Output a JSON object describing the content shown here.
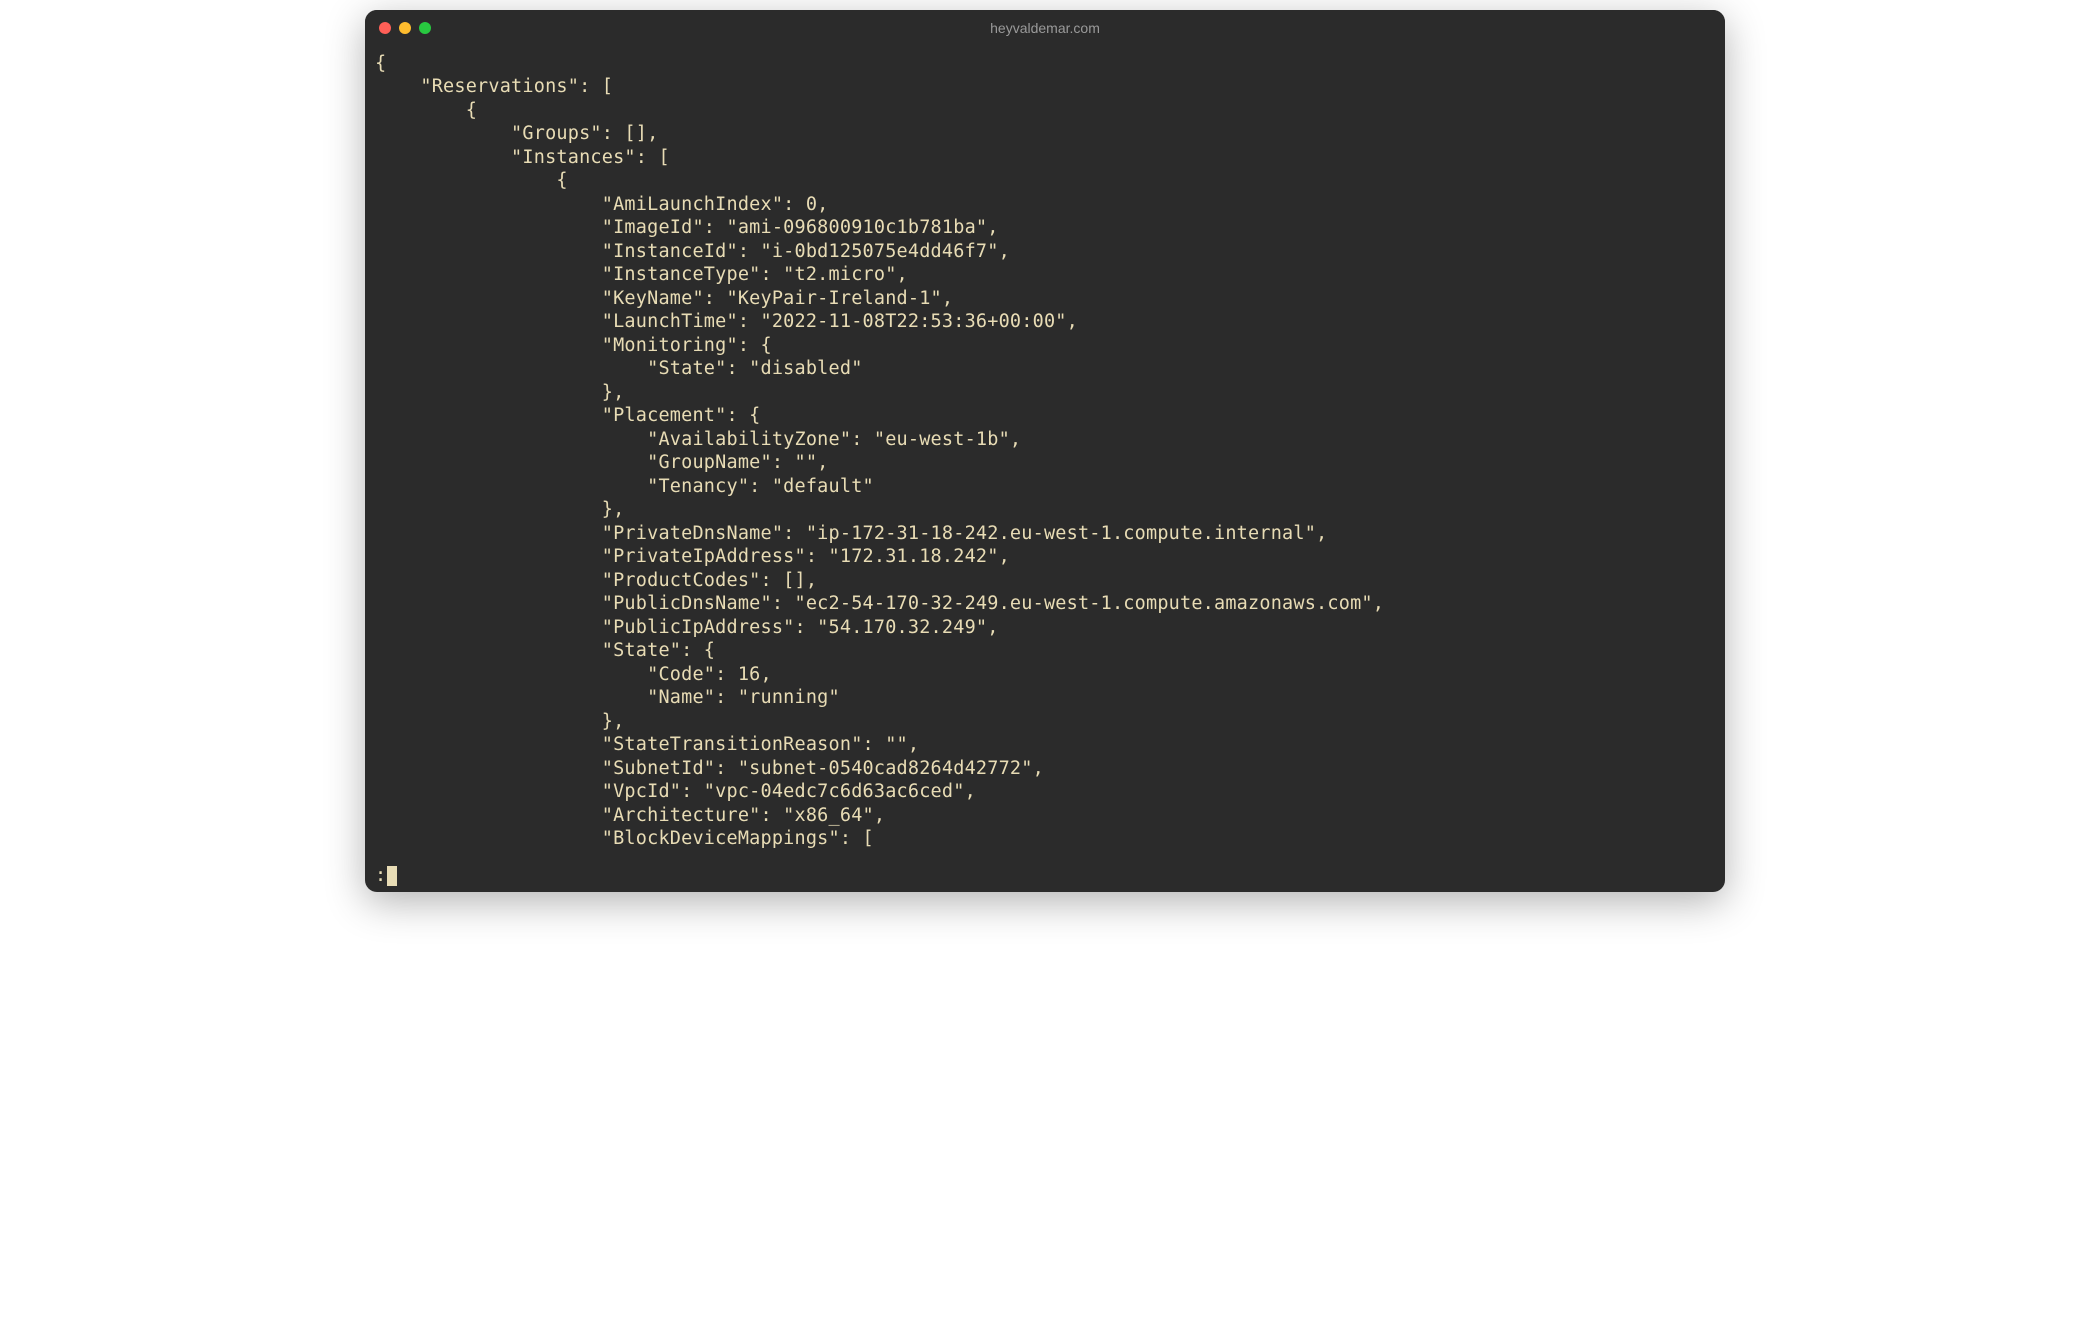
{
  "window": {
    "title": "heyvaldemar.com"
  },
  "pager": {
    "prompt": ":"
  },
  "json_output": {
    "lines": [
      "{",
      "    \"Reservations\": [",
      "        {",
      "            \"Groups\": [],",
      "            \"Instances\": [",
      "                {",
      "                    \"AmiLaunchIndex\": 0,",
      "                    \"ImageId\": \"ami-096800910c1b781ba\",",
      "                    \"InstanceId\": \"i-0bd125075e4dd46f7\",",
      "                    \"InstanceType\": \"t2.micro\",",
      "                    \"KeyName\": \"KeyPair-Ireland-1\",",
      "                    \"LaunchTime\": \"2022-11-08T22:53:36+00:00\",",
      "                    \"Monitoring\": {",
      "                        \"State\": \"disabled\"",
      "                    },",
      "                    \"Placement\": {",
      "                        \"AvailabilityZone\": \"eu-west-1b\",",
      "                        \"GroupName\": \"\",",
      "                        \"Tenancy\": \"default\"",
      "                    },",
      "                    \"PrivateDnsName\": \"ip-172-31-18-242.eu-west-1.compute.internal\",",
      "                    \"PrivateIpAddress\": \"172.31.18.242\",",
      "                    \"ProductCodes\": [],",
      "                    \"PublicDnsName\": \"ec2-54-170-32-249.eu-west-1.compute.amazonaws.com\",",
      "                    \"PublicIpAddress\": \"54.170.32.249\",",
      "                    \"State\": {",
      "                        \"Code\": 16,",
      "                        \"Name\": \"running\"",
      "                    },",
      "                    \"StateTransitionReason\": \"\",",
      "                    \"SubnetId\": \"subnet-0540cad8264d42772\",",
      "                    \"VpcId\": \"vpc-04edc7c6d63ac6ced\",",
      "                    \"Architecture\": \"x86_64\",",
      "                    \"BlockDeviceMappings\": ["
    ]
  }
}
